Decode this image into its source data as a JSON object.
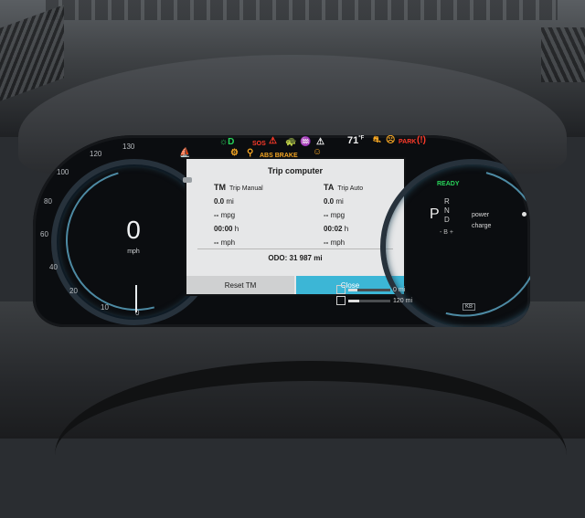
{
  "speedometer": {
    "ticks": [
      "130",
      "120",
      "100",
      "80",
      "60",
      "40",
      "20",
      "10",
      "0"
    ],
    "speed": "0",
    "unit": "mph"
  },
  "indicators": {
    "abs_brake": "ABS BRAKE",
    "sos": "SOS",
    "temperature": "71",
    "temperature_unit": "°F",
    "park": "PARK",
    "colors": {
      "green": "#28d45a",
      "red": "#ff3b2a",
      "amber": "#f5a623"
    }
  },
  "trip_computer": {
    "title": "Trip computer",
    "trip_manual": {
      "code": "TM",
      "label": "Trip Manual",
      "distance": "0.0",
      "distance_unit": "mi",
      "consumption": "-- ",
      "consumption_unit": "mpg",
      "time": "00:00",
      "time_unit": "h",
      "avg_speed": "-- ",
      "avg_speed_unit": "mph"
    },
    "trip_auto": {
      "code": "TA",
      "label": "Trip Auto",
      "distance": "0.0",
      "distance_unit": "mi",
      "consumption": "-- ",
      "consumption_unit": "mpg",
      "time": "00:02",
      "time_unit": "h",
      "avg_speed": "-- ",
      "avg_speed_unit": "mph"
    },
    "odometer": "ODO:  31 987 mi",
    "reset_label": "Reset TM",
    "close_label": "Close"
  },
  "powertrain": {
    "ready": "READY",
    "gear_selected": "P",
    "gears": [
      "R",
      "N",
      "D"
    ],
    "gear_extra": "- B +",
    "power_label": "power",
    "charge_label": "charge"
  },
  "range": {
    "electric": "0 mi",
    "fuel": "120 mi"
  },
  "badge": "KB"
}
